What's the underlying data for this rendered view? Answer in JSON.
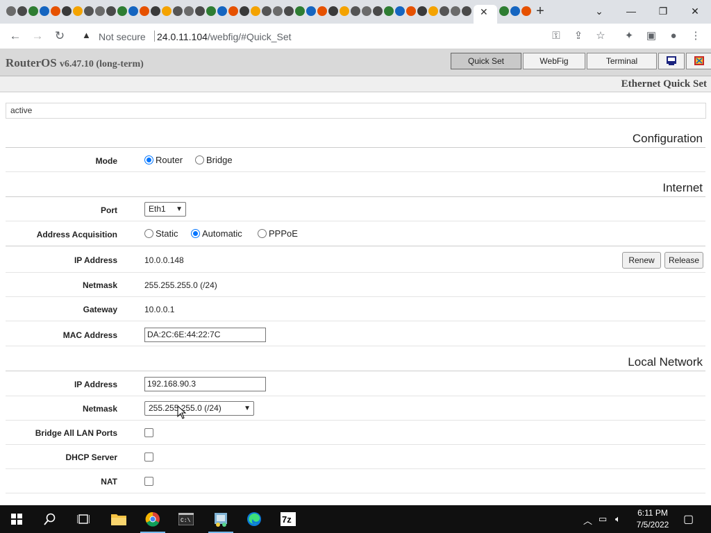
{
  "browser": {
    "tab_count_visible": 45,
    "active_tab_close": "✕",
    "new_tab": "+",
    "window": {
      "minimize": "—",
      "restore": "❐",
      "close": "✕",
      "tabs_dropdown": "⌄"
    },
    "security_label": "Not secure",
    "url_host": "24.0.11.104",
    "url_path": "/webfig/#Quick_Set",
    "icons": [
      "back-icon",
      "forward-icon",
      "reload-icon",
      "warning-icon",
      "key-icon",
      "share-icon",
      "star-icon",
      "extensions-icon",
      "sidepanel-icon",
      "profile-icon",
      "menu-icon"
    ]
  },
  "webfig": {
    "brand": "RouterOS",
    "version": "v6.47.10 (long-term)",
    "modes": [
      "Quick Set",
      "WebFig",
      "Terminal"
    ],
    "active_mode": "Quick Set",
    "page_title": "Ethernet Quick Set",
    "status": "active",
    "configuration": {
      "heading": "Configuration",
      "mode_label": "Mode",
      "mode_options": [
        "Router",
        "Bridge"
      ],
      "mode_selected": "Router"
    },
    "internet": {
      "heading": "Internet",
      "port_label": "Port",
      "port_value": "Eth1",
      "acq_label": "Address Acquisition",
      "acq_options": [
        "Static",
        "Automatic",
        "PPPoE"
      ],
      "acq_selected": "Automatic",
      "ip_label": "IP Address",
      "ip_value": "10.0.0.148",
      "renew": "Renew",
      "release": "Release",
      "netmask_label": "Netmask",
      "netmask_value": "255.255.255.0 (/24)",
      "gateway_label": "Gateway",
      "gateway_value": "10.0.0.1",
      "mac_label": "MAC Address",
      "mac_value": "DA:2C:6E:44:22:7C"
    },
    "local": {
      "heading": "Local Network",
      "ip_label": "IP Address",
      "ip_value": "192.168.90.3",
      "netmask_label": "Netmask",
      "netmask_value": "255.255.255.0 (/24)",
      "bridge_label": "Bridge All LAN Ports",
      "bridge_checked": false,
      "dhcp_label": "DHCP Server",
      "dhcp_checked": false,
      "nat_label": "NAT",
      "nat_checked": false
    }
  },
  "taskbar": {
    "apps": [
      "start-icon",
      "search-icon",
      "task-view-icon",
      "file-explorer-icon",
      "chrome-icon",
      "terminal-icon",
      "network-app-icon",
      "edge-icon",
      "7zip-icon"
    ],
    "active_app": "chrome-icon",
    "time": "6:11 PM",
    "date": "7/5/2022"
  },
  "colors": {
    "accent": "#0075ff",
    "header_bg": "#d9d9d9",
    "taskbar": "#101010"
  }
}
